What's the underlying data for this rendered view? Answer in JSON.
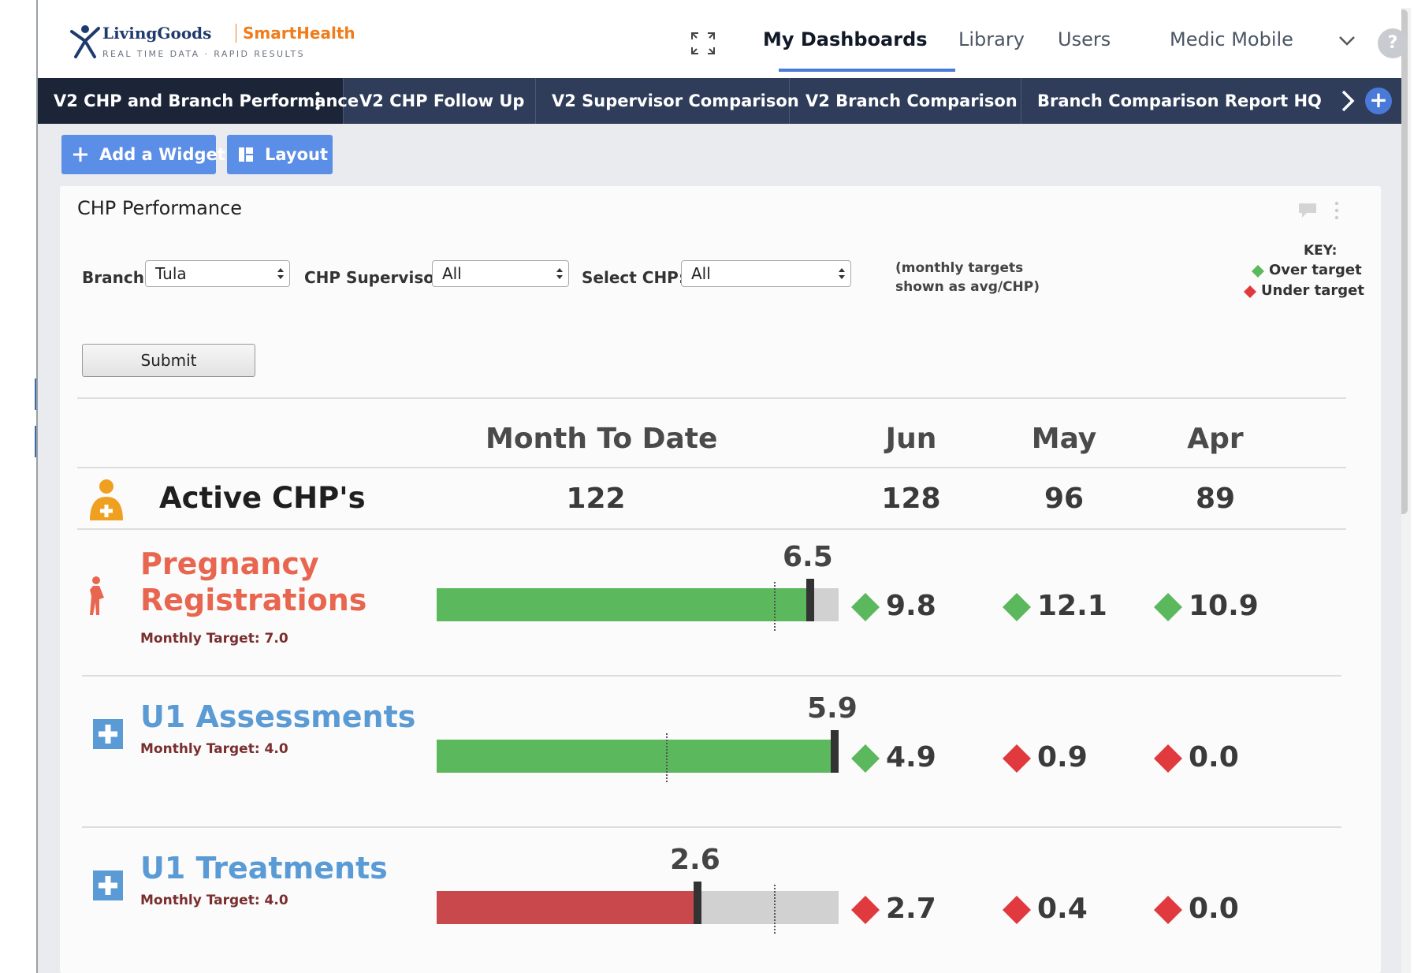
{
  "brand": {
    "name_part1": "LivingGoods",
    "name_part2": "SmartHealth",
    "tagline": "REAL TIME DATA · RAPID RESULTS"
  },
  "topnav": {
    "items": [
      "My Dashboards",
      "Library",
      "Users",
      "Medic Mobile"
    ],
    "active": "My Dashboards",
    "help": "?"
  },
  "tabs": [
    "V2 CHP and Branch Performance",
    "V2 CHP Follow Up",
    "V2 Supervisor Comparison",
    "V2 Branch Comparison",
    "Branch Comparison Report HQ"
  ],
  "active_tab": "V2 CHP and Branch Performance",
  "toolbar": {
    "add_widget": "Add a Widget",
    "layout": "Layout"
  },
  "widget": {
    "title": "CHP Performance",
    "filters": {
      "branch_label": "Branch:",
      "branch_value": "Tula",
      "supervisor_label": "CHP Supervisor:",
      "supervisor_value": "All",
      "chp_label": "Select CHP:",
      "chp_value": "All"
    },
    "note_line1": "(monthly targets",
    "note_line2": "shown as avg/CHP)",
    "key": {
      "title": "KEY:",
      "over": "Over target",
      "under": "Under target"
    },
    "submit": "Submit",
    "columns": [
      "Month To Date",
      "Jun",
      "May",
      "Apr"
    ],
    "active_chps": {
      "label": "Active CHP's",
      "values": [
        "122",
        "128",
        "96",
        "89"
      ]
    },
    "metrics": [
      {
        "title_line1": "Pregnancy",
        "title_line2": "Registrations",
        "target_label": "Monthly Target: 7.0",
        "target": 7.0,
        "mtd": "6.5",
        "mtd_num": 6.5,
        "bar_fill_fraction": 0.92,
        "bar_target_fraction": 0.84,
        "bar_color": "#5cb85c",
        "months": [
          {
            "value": "9.8",
            "status": "over"
          },
          {
            "value": "12.1",
            "status": "over"
          },
          {
            "value": "10.9",
            "status": "over"
          }
        ]
      },
      {
        "title_line1": "U1 Assessments",
        "title_line2": "",
        "target_label": "Monthly Target: 4.0",
        "target": 4.0,
        "mtd": "5.9",
        "mtd_num": 5.9,
        "bar_fill_fraction": 1.0,
        "bar_target_fraction": 0.57,
        "bar_color": "#5cb85c",
        "months": [
          {
            "value": "4.9",
            "status": "over"
          },
          {
            "value": "0.9",
            "status": "under"
          },
          {
            "value": "0.0",
            "status": "under"
          }
        ]
      },
      {
        "title_line1": "U1 Treatments",
        "title_line2": "",
        "target_label": "Monthly Target: 4.0",
        "target": 4.0,
        "mtd": "2.6",
        "mtd_num": 2.6,
        "bar_fill_fraction": 0.64,
        "bar_target_fraction": 0.84,
        "bar_color": "#c9484b",
        "months": [
          {
            "value": "2.7",
            "status": "under"
          },
          {
            "value": "0.4",
            "status": "under"
          },
          {
            "value": "0.0",
            "status": "under"
          }
        ]
      }
    ]
  },
  "colors": {
    "tabbar": "#2f3d5a",
    "accent": "#4a7ad8",
    "over": "#5cb85c",
    "under": "#e0393e",
    "pregnancy_title": "#e8664f",
    "u1_title": "#5b9bd5",
    "active_chp_icon": "#f0a020"
  },
  "icons": {
    "fullscreen": "expand-arrows-icon",
    "chevron": "chevron-down-icon",
    "tab_next": "chevron-right-icon",
    "tab_add": "plus-circle-icon",
    "add_widget": "plus-icon",
    "layout": "layout-grid-icon",
    "comment": "comment-icon",
    "kebab": "kebab-menu-icon",
    "active_chp": "health-worker-icon",
    "pregnancy": "pregnant-woman-icon",
    "u1": "medical-cross-icon"
  }
}
